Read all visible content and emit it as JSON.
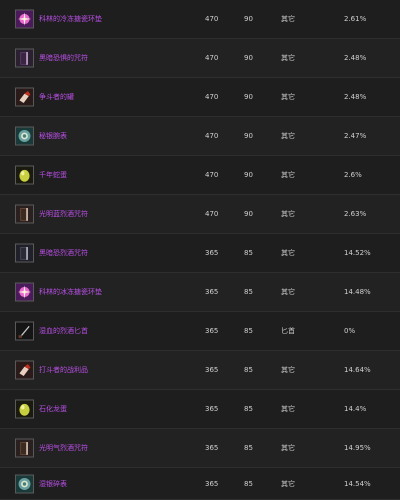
{
  "rows": [
    {
      "icon": "spark-trinket-icon",
      "name": "科林的冷冻搪瓷环垫",
      "level": "470",
      "req": "90",
      "slot": "其它",
      "pct": "2.61%"
    },
    {
      "icon": "dark-tome-icon",
      "name": "黑暗恐惧的咒符",
      "level": "470",
      "req": "90",
      "slot": "其它",
      "pct": "2.48%"
    },
    {
      "icon": "fist-weapon-icon",
      "name": "争斗者的罐",
      "level": "470",
      "req": "90",
      "slot": "其它",
      "pct": "2.48%"
    },
    {
      "icon": "relic-disc-icon",
      "name": "秘银腕表",
      "level": "470",
      "req": "90",
      "slot": "其它",
      "pct": "2.47%"
    },
    {
      "icon": "yellow-egg-icon",
      "name": "千年蛇蛋",
      "level": "470",
      "req": "90",
      "slot": "其它",
      "pct": "2.6%"
    },
    {
      "icon": "dark-tome-icon",
      "name": "光明蓝烈酒咒符",
      "level": "470",
      "req": "90",
      "slot": "其它",
      "pct": "2.63%"
    },
    {
      "icon": "dark-tome-icon",
      "name": "黑暗恐烈酒咒符",
      "level": "365",
      "req": "85",
      "slot": "其它",
      "pct": "14.52%"
    },
    {
      "icon": "spark-trinket-icon",
      "name": "科林的冰冻搪瓷环垫",
      "level": "365",
      "req": "85",
      "slot": "其它",
      "pct": "14.48%"
    },
    {
      "icon": "dagger-icon",
      "name": "湿血的烈酒匕首",
      "level": "365",
      "req": "85",
      "slot": "匕首",
      "pct": "0%"
    },
    {
      "icon": "fist-weapon-icon",
      "name": "打斗者的战利品",
      "level": "365",
      "req": "85",
      "slot": "其它",
      "pct": "14.64%"
    },
    {
      "icon": "yellow-egg-icon",
      "name": "石化龙蛋",
      "level": "365",
      "req": "85",
      "slot": "其它",
      "pct": "14.4%"
    },
    {
      "icon": "dark-tome-icon",
      "name": "光明气烈酒咒符",
      "level": "365",
      "req": "85",
      "slot": "其它",
      "pct": "14.95%"
    },
    {
      "icon": "relic-disc-icon",
      "name": "湿银碎表",
      "level": "365",
      "req": "85",
      "slot": "其它",
      "pct": "14.54%"
    }
  ]
}
